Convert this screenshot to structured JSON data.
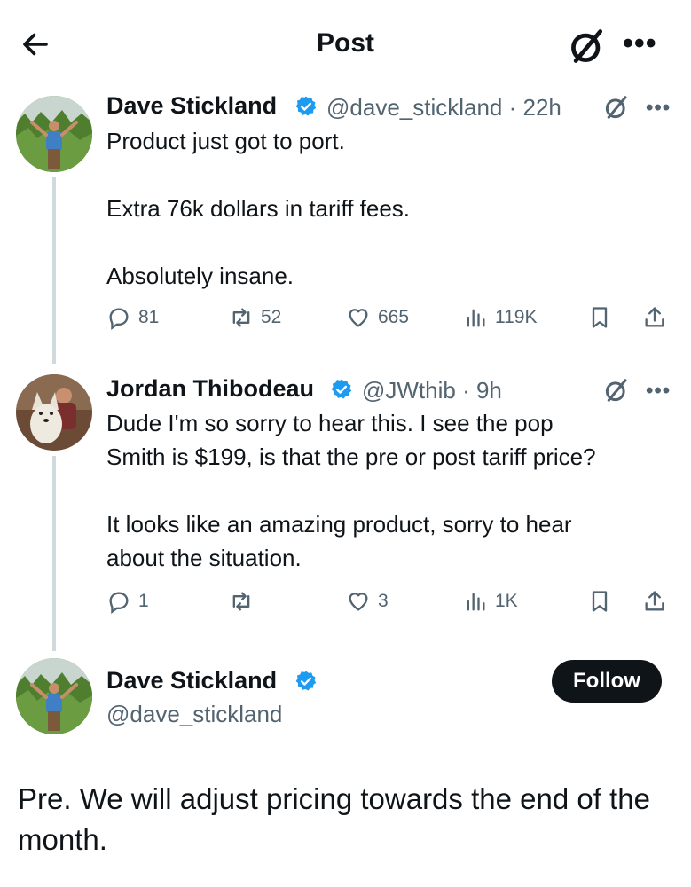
{
  "header": {
    "title": "Post"
  },
  "tweets": [
    {
      "name": "Dave Stickland",
      "handle": "@dave_stickland",
      "time": "22h",
      "text": "Product just got to port.\n\nExtra 76k dollars in tariff fees.\n\nAbsolutely insane.",
      "replies": "81",
      "reposts": "52",
      "likes": "665",
      "views": "119K"
    },
    {
      "name": "Jordan Thibodeau",
      "handle": "@JWthib",
      "time": "9h",
      "text": "Dude I'm so sorry to hear this. I see the pop\nSmith is $199, is that the pre or post tariff price?\n\nIt looks like an amazing product, sorry to hear\nabout the situation.",
      "replies": "1",
      "reposts": "",
      "likes": "3",
      "views": "1K"
    }
  ],
  "main_post": {
    "name": "Dave Stickland",
    "handle": "@dave_stickland",
    "follow_label": "Follow",
    "text": "Pre. We will adjust pricing towards the end of the month."
  },
  "colors": {
    "verified": "#1d9bf0",
    "muted": "#536471",
    "thread": "#cfd9de"
  }
}
